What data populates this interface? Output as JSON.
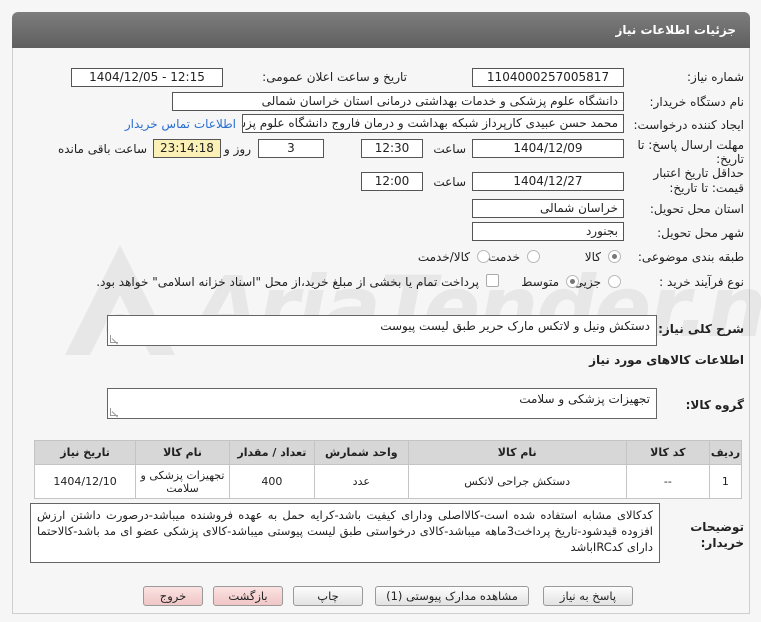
{
  "header": {
    "title": "جزئیات اطلاعات نیاز"
  },
  "watermark": {
    "text": "AriaTender.net"
  },
  "fields": {
    "need_number_label": "شماره نیاز:",
    "need_number": "1104000257005817",
    "announce_label": "تاریخ و ساعت اعلان عمومی:",
    "announce_value": "1404/12/05 - 12:15",
    "buyer_label": "نام دستگاه خریدار:",
    "buyer": "دانشگاه علوم پزشکی و خدمات بهداشتی درمانی استان خراسان شمالی",
    "creator_label": "ایجاد کننده درخواست:",
    "creator": "محمد حسن عبیدی کارپرداز شبکه بهداشت و درمان فاروج دانشگاه علوم پزشکی",
    "contact_link": "اطلاعات تماس خریدار",
    "deadline_label": "مهلت ارسال پاسخ: تا",
    "deadline_label2": "تاریخ:",
    "deadline_date": "1404/12/09",
    "time_label": "ساعت",
    "deadline_time": "12:30",
    "days": "3",
    "days_and": "روز و",
    "remaining": "23:14:18",
    "remaining_label": "ساعت باقی مانده",
    "validity_label": "حداقل تاریخ اعتبار",
    "validity_label2": "قیمت: تا تاریخ:",
    "validity_date": "1404/12/27",
    "validity_time": "12:00",
    "province_label": "استان محل تحویل:",
    "province": "خراسان شمالی",
    "city_label": "شهر محل تحویل:",
    "city": "بجنورد",
    "category_label": "طبقه بندی موضوعی:",
    "cat_goods": "کالا",
    "cat_service": "خدمت",
    "cat_goods_service": "کالا/خدمت",
    "process_label": "نوع فرآیند خرید :",
    "proc_partial": "جزیی",
    "proc_medium": "متوسط",
    "payment_note": "پرداخت تمام یا بخشی از مبلغ خرید،از محل \"اسناد خزانه اسلامی\" خواهد بود."
  },
  "description": {
    "label": "شرح کلی نیاز:",
    "value": "دستکش ونیل و لاتکس مارک حریر طبق لیست پیوست"
  },
  "goods_info_title": "اطلاعات کالاهای مورد نیاز",
  "goods_group": {
    "label": "گروه کالا:",
    "value": "تجهیزات پزشکی و سلامت"
  },
  "table": {
    "headers": [
      "ردیف",
      "کد کالا",
      "نام کالا",
      "واحد شمارش",
      "تعداد / مقدار",
      "نام کالا",
      "تاریخ نیاز"
    ],
    "rows": [
      [
        "1",
        "--",
        "دستکش جراحی لاتکس",
        "عدد",
        "400",
        "تجهیزات پزشکی و سلامت",
        "1404/12/10"
      ]
    ]
  },
  "notes": {
    "label": "توضیحات",
    "label2": "خریدار:",
    "value": "کدکالای مشابه استفاده شده است-کالااصلی ودارای کیفیت باشد-کرایه حمل به عهده فروشنده میباشد-درصورت داشتن ارزش افزوده قیدشود-تاریخ پرداخت3ماهه میباشد-کالای درخواستی طبق لیست پیوستی میباشد-کالای پزشکی عضو ای مد باشد-کالاحتما دارای کدIRCباشد"
  },
  "buttons": {
    "reply": "پاسخ به نیاز",
    "attachments": "مشاهده مدارک پیوستی (1)",
    "print": "چاپ",
    "back": "بازگشت",
    "exit": "خروج"
  }
}
